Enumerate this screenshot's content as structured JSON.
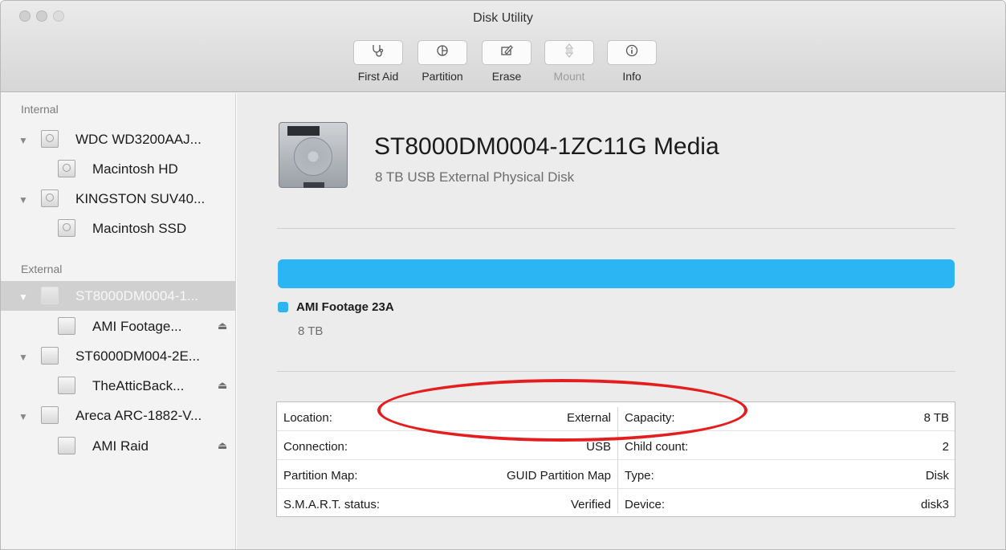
{
  "window": {
    "title": "Disk Utility"
  },
  "toolbar": {
    "buttons": [
      {
        "label": "First Aid",
        "icon": "stethoscope-icon",
        "enabled": true
      },
      {
        "label": "Partition",
        "icon": "pie-chart-icon",
        "enabled": true
      },
      {
        "label": "Erase",
        "icon": "erase-icon",
        "enabled": true
      },
      {
        "label": "Mount",
        "icon": "mount-icon",
        "enabled": false
      },
      {
        "label": "Info",
        "icon": "info-icon",
        "enabled": true
      }
    ]
  },
  "sidebar": {
    "internal_label": "Internal",
    "external_label": "External",
    "items": [
      {
        "name": "WDC WD3200AAJ...",
        "icon": "hard-disk-icon"
      },
      {
        "name": "Macintosh HD",
        "icon": "volume-icon"
      },
      {
        "name": "KINGSTON SUV40...",
        "icon": "hard-disk-icon"
      },
      {
        "name": "Macintosh SSD",
        "icon": "volume-icon"
      },
      {
        "name": "ST8000DM0004-1...",
        "icon": "external-disk-icon",
        "selected": true
      },
      {
        "name": "AMI Footage...",
        "icon": "external-volume-icon",
        "eject": "⏏"
      },
      {
        "name": "ST6000DM004-2E...",
        "icon": "external-disk-icon"
      },
      {
        "name": "TheAtticBack...",
        "icon": "external-volume-icon",
        "eject": "⏏"
      },
      {
        "name": "Areca ARC-1882-V...",
        "icon": "external-disk-icon"
      },
      {
        "name": "AMI Raid",
        "icon": "external-volume-icon",
        "eject": "⏏"
      }
    ]
  },
  "main": {
    "disk_title": "ST8000DM0004-1ZC11G Media",
    "disk_subtitle": "8 TB USB External Physical Disk",
    "usage_bar_color": "#2bb6f3",
    "partition": {
      "name": "AMI Footage 23A",
      "size": "8 TB",
      "color": "#2bb6f3"
    },
    "info_left": [
      {
        "key": "Location:",
        "value": "External"
      },
      {
        "key": "Connection:",
        "value": "USB"
      },
      {
        "key": "Partition Map:",
        "value": "GUID Partition Map"
      },
      {
        "key": "S.M.A.R.T. status:",
        "value": "Verified"
      }
    ],
    "info_right": [
      {
        "key": "Capacity:",
        "value": "8 TB"
      },
      {
        "key": "Child count:",
        "value": "2"
      },
      {
        "key": "Type:",
        "value": "Disk"
      },
      {
        "key": "Device:",
        "value": "disk3"
      }
    ],
    "annotation_color": "#e41e1e"
  }
}
